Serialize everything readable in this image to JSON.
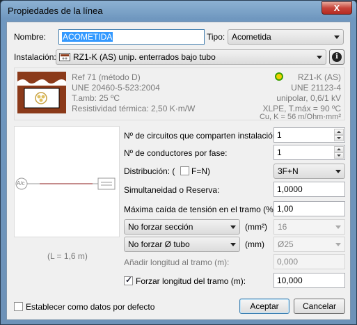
{
  "window": {
    "title": "Propiedades de la línea",
    "close_label": "X"
  },
  "nombre": {
    "label": "Nombre:",
    "value": "ACOMETIDA"
  },
  "tipo": {
    "label": "Tipo:",
    "value": "Acometida"
  },
  "instalacion": {
    "label": "Instalación:",
    "value": "RZ1-K (AS) unip. enterrados bajo tubo",
    "info_label": "i"
  },
  "cable_info": {
    "ref": "Ref 71 (método D)",
    "norma": "UNE 20460-5-523:2004",
    "tamb": "T.amb: 25 ºC",
    "resistividad": "Resistividad térmica: 2,50 K·m/W",
    "cable_name": "RZ1-K (AS)",
    "cable_norma": "UNE 21123-4",
    "tension": "unipolar, 0,6/1 kV",
    "aislamiento": "XLPE, T.máx = 90 ºC",
    "conductor": "Cu, K = 56 m/Ohm·mm²"
  },
  "diagram": {
    "node_label": "A/c",
    "length_label": "(L = 1,6 m)"
  },
  "form": {
    "circuitos": {
      "label": "Nº de circuitos que comparten instalación:",
      "value": "1"
    },
    "conductores": {
      "label": "Nº de conductores por fase:",
      "value": "1"
    },
    "distribucion": {
      "label_pre": "Distribución: (",
      "check_label": "F=N)",
      "value": "3F+N",
      "checked": false
    },
    "simultaneidad": {
      "label": "Simultaneidad o Reserva:",
      "value": "1,0000"
    },
    "caida": {
      "label": "Máxima caída de tensión en el tramo (%):",
      "value": "1,00"
    },
    "seccion": {
      "select": "No forzar sección",
      "unit": "(mm²)",
      "value": "16"
    },
    "tubo": {
      "select": "No forzar Ø tubo",
      "unit": "(mm)",
      "value": "Ø25"
    },
    "anadir": {
      "label": "Añadir longitud al tramo (m):",
      "value": "0,000"
    },
    "forzar": {
      "label": "Forzar longitud del tramo (m):",
      "value": "10,000",
      "checked": true
    }
  },
  "footer": {
    "default_label": "Establecer como datos por defecto",
    "default_checked": false,
    "accept": "Aceptar",
    "cancel": "Cancelar"
  },
  "colors": {
    "title_bg": "#7aa2c8",
    "close_red": "#c7443a",
    "cable_brown": "#8b3a1a",
    "status_green": "#3aa000",
    "status_yellow": "#f0d000"
  }
}
